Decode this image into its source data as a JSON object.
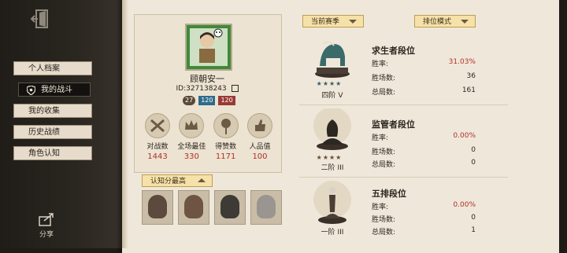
{
  "sidebar": {
    "items": [
      {
        "label": "个人档案"
      },
      {
        "label": "我的战斗"
      },
      {
        "label": "我的收集"
      },
      {
        "label": "历史战绩"
      },
      {
        "label": "角色认知"
      }
    ],
    "share_label": "分享"
  },
  "profile": {
    "name": "顾朝安一",
    "id": "ID:327138243",
    "level": "27",
    "badge1": "120",
    "badge2": "120"
  },
  "stats": [
    {
      "label": "对战数",
      "value": "1443",
      "icon": "crossed-weapons-icon"
    },
    {
      "label": "全场最佳",
      "value": "330",
      "icon": "crown-icon"
    },
    {
      "label": "得赞数",
      "value": "1171",
      "icon": "rose-icon"
    },
    {
      "label": "人品值",
      "value": "100",
      "icon": "thumbs-up-icon"
    }
  ],
  "cognition_dropdown": {
    "label": "认知分最高"
  },
  "season_dropdown": {
    "label": "当前赛季"
  },
  "mode_dropdown": {
    "label": "排位模式"
  },
  "ranks": [
    {
      "title": "求生者段位",
      "tier": "四阶 V",
      "winrate_label": "胜率:",
      "winrate": "31.03%",
      "wins_label": "胜场数:",
      "wins": "36",
      "total_label": "总局数:",
      "total": "161",
      "icon": "mammoth-trophy-icon"
    },
    {
      "title": "监管者段位",
      "tier": "二阶 III",
      "winrate_label": "胜率:",
      "winrate": "0.00%",
      "wins_label": "胜场数:",
      "wins": "0",
      "total_label": "总局数:",
      "total": "0",
      "icon": "cobra-trophy-icon"
    },
    {
      "title": "五排段位",
      "tier": "一阶 III",
      "winrate_label": "胜率:",
      "winrate": "0.00%",
      "wins_label": "胜场数:",
      "wins": "0",
      "total_label": "总局数:",
      "total": "1",
      "icon": "pawn-trophy-icon"
    }
  ],
  "colors": {
    "accent_red": "#b0302a",
    "paper": "#efe8da",
    "panel": "#2a2620"
  }
}
